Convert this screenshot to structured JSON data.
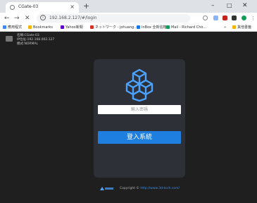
{
  "browser": {
    "tab_title": "CGate-03",
    "tab_close": "×",
    "new_tab": "+",
    "window_min": "–",
    "window_max": "□",
    "window_close": "✕",
    "nav_back": "←",
    "nav_forward": "→",
    "nav_reload": "✕",
    "url": "192.168.2.127/#/login",
    "info_icon": "i",
    "bookmarks": [
      {
        "label": "應用程式",
        "color": "#4285f4"
      },
      {
        "label": "Bookmarks",
        "color": "#f4b400"
      },
      {
        "label": "Yahoo新聞",
        "color": "#6001d2"
      },
      {
        "label": "ネットワーク - johuang...",
        "color": "#d93025"
      },
      {
        "label": "InBox 全新信箱",
        "color": "#1a73e8"
      },
      {
        "label": "Mail - Richard Cho...",
        "color": "#0f9d58"
      }
    ],
    "bookmarks_more": "»",
    "bookmarks_other": "其他書籤"
  },
  "device": {
    "name_line": "名稱:CGate-03",
    "ip_line": "IP位址:192.168.002.127",
    "mode_line": "模式:NORMAL"
  },
  "login": {
    "password_placeholder": "輸入密碼",
    "submit_label": "登入系統"
  },
  "footer": {
    "copyright": "Copyright © ",
    "link_text": "http://www.3d-tech.com/"
  },
  "colors": {
    "page_bg": "#1f1f1f",
    "card_bg": "#2e3037",
    "accent_blue": "#1f7fe0",
    "logo_blue": "#4aa3ff"
  }
}
